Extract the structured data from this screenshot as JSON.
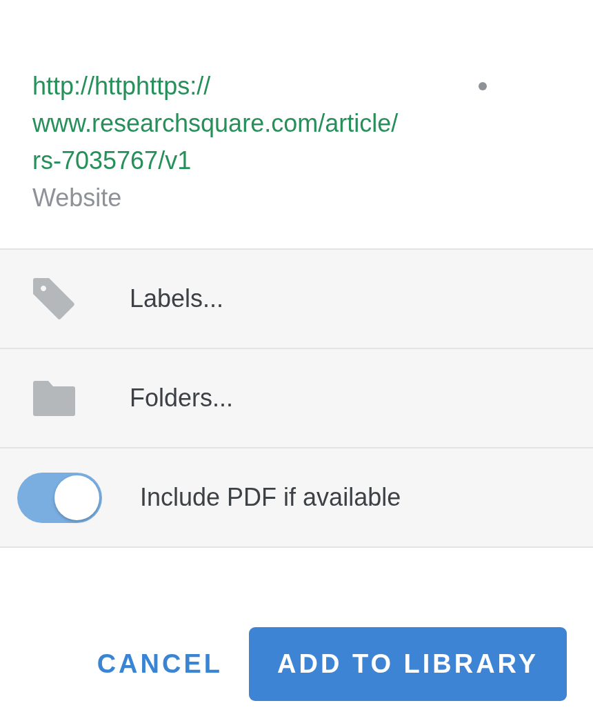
{
  "item": {
    "title": "http://httphttps://www.researchsquare.com/article/rs-7035767/v1",
    "type": "Website"
  },
  "labels": {
    "label": "Labels..."
  },
  "folders": {
    "label": "Folders..."
  },
  "include_pdf": {
    "label": "Include PDF if available",
    "on": true
  },
  "buttons": [
    {
      "label": "CANCEL",
      "kind": "text"
    },
    {
      "label": "ADD TO LIBRARY",
      "kind": "primary"
    }
  ]
}
